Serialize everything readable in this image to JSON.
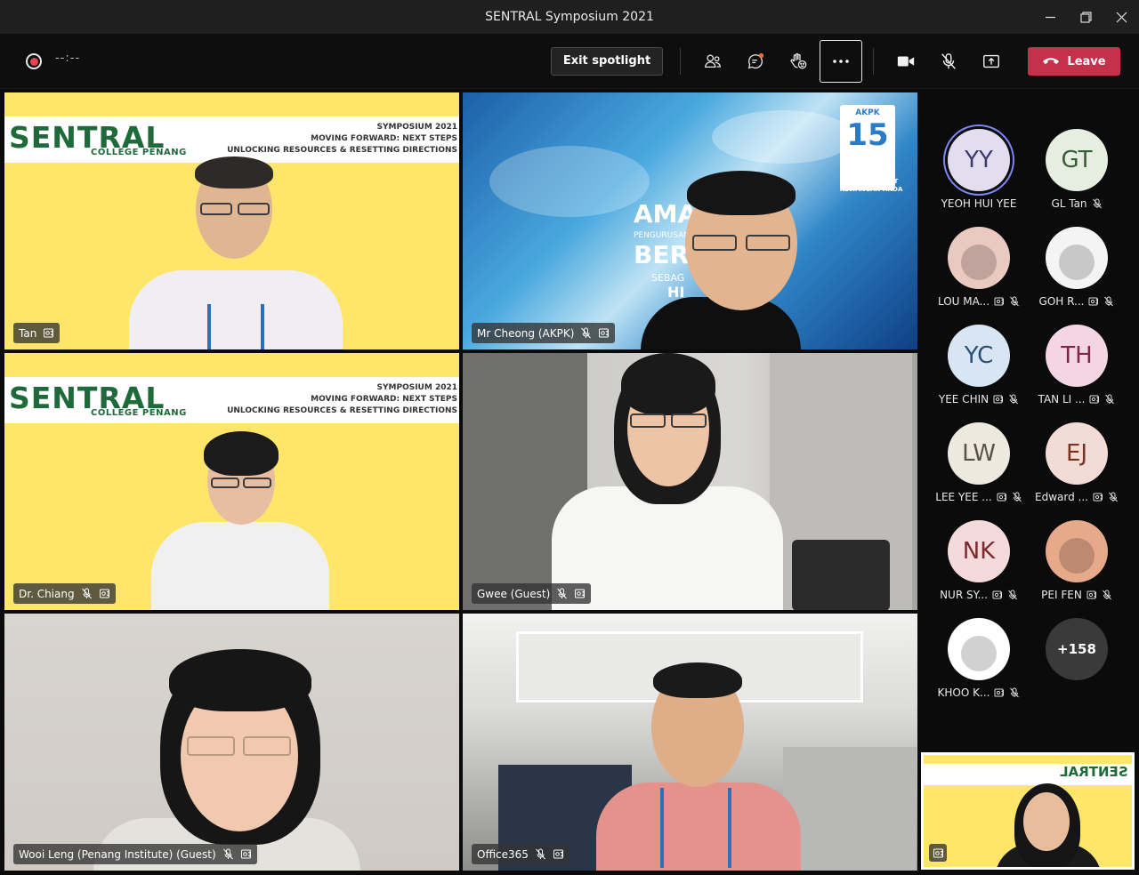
{
  "window": {
    "title": "SENTRAL Symposium 2021"
  },
  "toolbar": {
    "record_time": "--:--",
    "exit_spotlight": "Exit spotlight",
    "leave": "Leave"
  },
  "banner": {
    "logo": "SENTRAL",
    "college": "COLLEGE PENANG",
    "line1": "SYMPOSIUM 2021",
    "line2": "MOVING FORWARD: NEXT STEPS",
    "line3": "UNLOCKING RESOURCES & RESETTING DIRECTIONS"
  },
  "tiles": [
    {
      "name": "Tan",
      "muted": false
    },
    {
      "name": "Mr Cheong (AKPK)",
      "muted": true
    },
    {
      "name": "Dr. Chiang",
      "muted": true
    },
    {
      "name": "Gwee (Guest)",
      "muted": true
    },
    {
      "name": "Wooi Leng (Penang Institute) (Guest)",
      "muted": true
    },
    {
      "name": "Office365",
      "muted": true
    }
  ],
  "akpk": {
    "logo": "AKPK",
    "anniversary": "15",
    "tagline_1": "AKPK SAHABAT",
    "tagline_2": "KEWANGAN ANDA",
    "bg_text_1": "AMAL",
    "bg_text_2": "PENGURUSAN",
    "bg_text_3": "BERH",
    "bg_text_4": "SEBAG",
    "bg_text_5": "HI"
  },
  "roster": [
    {
      "initials": "YY",
      "name": "YEOH HUI YEE",
      "bg": "#e2def0",
      "fg": "#3d3a6b",
      "speaking": true,
      "icons": []
    },
    {
      "initials": "GT",
      "name": "GL Tan",
      "bg": "#e5eee0",
      "fg": "#3a5a36",
      "icons": [
        "mic-off"
      ]
    },
    {
      "initials": "",
      "name": "LOU MA...",
      "bg": "#e9c9c0",
      "photo": true,
      "icons": [
        "video-off",
        "mic-off"
      ]
    },
    {
      "initials": "",
      "name": "GOH R...",
      "bg": "#f4f4f4",
      "photo": true,
      "icons": [
        "video-off",
        "mic-off"
      ]
    },
    {
      "initials": "YC",
      "name": "YEE CHIN",
      "bg": "#d8e6f3",
      "fg": "#2c4f73",
      "icons": [
        "video-off",
        "mic-off"
      ]
    },
    {
      "initials": "TH",
      "name": "TAN LI ...",
      "bg": "#f3d6e2",
      "fg": "#7a2748",
      "icons": [
        "video-off",
        "mic-off"
      ]
    },
    {
      "initials": "LW",
      "name": "LEE YEE ...",
      "bg": "#eee9df",
      "fg": "#5a5242",
      "icons": [
        "video-off",
        "mic-off"
      ]
    },
    {
      "initials": "EJ",
      "name": "Edward ...",
      "bg": "#f3dcd5",
      "fg": "#7a3321",
      "icons": [
        "video-off",
        "mic-off"
      ]
    },
    {
      "initials": "NK",
      "name": "NUR SY...",
      "bg": "#f4dadb",
      "fg": "#7a2a31",
      "icons": [
        "video-off",
        "mic-off"
      ]
    },
    {
      "initials": "",
      "name": "PEI FEN",
      "bg": "#e6a98a",
      "photo": true,
      "icons": [
        "video-off",
        "mic-off"
      ]
    },
    {
      "initials": "",
      "name": "KHOO K...",
      "bg": "#ffffff",
      "photo": true,
      "icons": [
        "video-off",
        "mic-off"
      ]
    },
    {
      "initials": "+158",
      "name": "",
      "bg": "#3a3a3a",
      "fg": "#ffffff",
      "icons": []
    }
  ],
  "colors": {
    "accent_red": "#c4314b",
    "banner_yellow": "#fde66a",
    "logo_green": "#1f6a3a"
  }
}
